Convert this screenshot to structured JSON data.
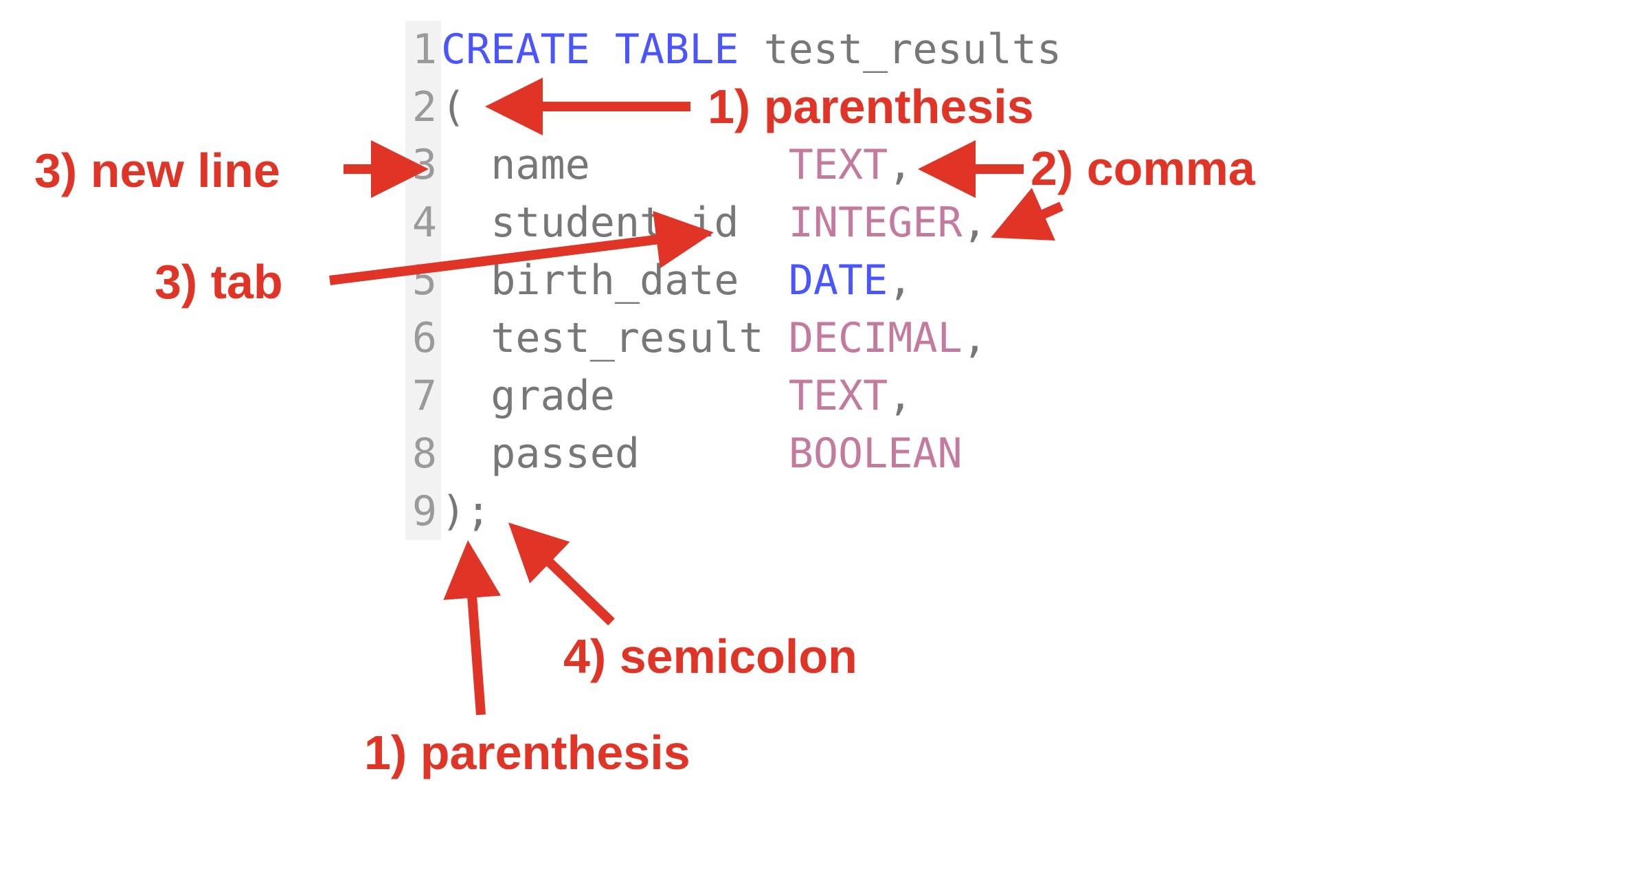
{
  "code": {
    "lines": [
      {
        "num": "1",
        "tokens": [
          {
            "cls": "kw",
            "text": "CREATE"
          },
          {
            "cls": "punct",
            "text": " "
          },
          {
            "cls": "kw",
            "text": "TABLE"
          },
          {
            "cls": "punct",
            "text": " "
          },
          {
            "cls": "ident",
            "text": "test_results"
          }
        ]
      },
      {
        "num": "2",
        "tokens": [
          {
            "cls": "ident",
            "text": "("
          }
        ]
      },
      {
        "num": "3",
        "tokens": [
          {
            "cls": "ident",
            "text": "  name        "
          },
          {
            "cls": "type-kw",
            "text": "TEXT"
          },
          {
            "cls": "ident",
            "text": ","
          }
        ]
      },
      {
        "num": "4",
        "tokens": [
          {
            "cls": "ident",
            "text": "  student_id  "
          },
          {
            "cls": "type-kw",
            "text": "INTEGER"
          },
          {
            "cls": "ident",
            "text": ","
          }
        ]
      },
      {
        "num": "5",
        "tokens": [
          {
            "cls": "ident",
            "text": "  birth_date  "
          },
          {
            "cls": "date-kw",
            "text": "DATE"
          },
          {
            "cls": "ident",
            "text": ","
          }
        ]
      },
      {
        "num": "6",
        "tokens": [
          {
            "cls": "ident",
            "text": "  test_result "
          },
          {
            "cls": "type-kw",
            "text": "DECIMAL"
          },
          {
            "cls": "ident",
            "text": ","
          }
        ]
      },
      {
        "num": "7",
        "tokens": [
          {
            "cls": "ident",
            "text": "  grade       "
          },
          {
            "cls": "type-kw",
            "text": "TEXT"
          },
          {
            "cls": "ident",
            "text": ","
          }
        ]
      },
      {
        "num": "8",
        "tokens": [
          {
            "cls": "ident",
            "text": "  passed      "
          },
          {
            "cls": "type-kw",
            "text": "BOOLEAN"
          }
        ]
      },
      {
        "num": "9",
        "tokens": [
          {
            "cls": "ident",
            "text": ");"
          }
        ]
      }
    ]
  },
  "annotations": {
    "parenthesis_top": "1) parenthesis",
    "comma": "2) comma",
    "new_line": "3) new line",
    "tab": "3) tab",
    "semicolon": "4) semicolon",
    "parenthesis_bot": "1) parenthesis"
  }
}
